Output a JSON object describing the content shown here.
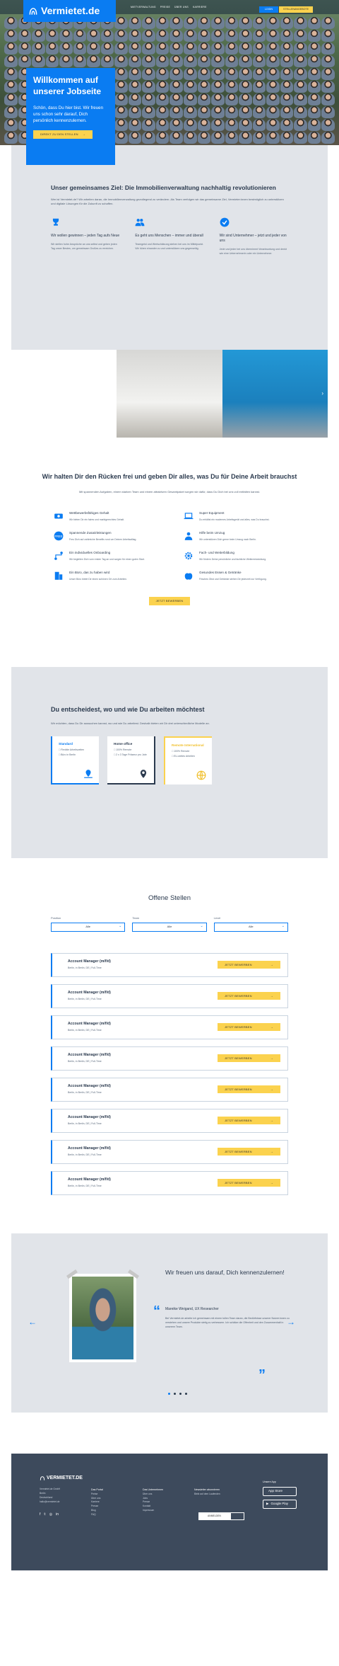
{
  "brand": "Vermietet.de",
  "nav": [
    "MIETVERWALTUNG",
    "PREISE",
    "ÜBER UNS",
    "KARRIERE"
  ],
  "login": "LOGIN",
  "jobs_btn": "STELLENANGEBOTE",
  "hero": {
    "title": "Willkommen auf unserer Jobseite",
    "subtitle": "Schön, dass Du hier bist. Wir freuen uns schon sehr darauf, Dich persönlich kennenzulernen.",
    "cta": "DIREKT ZU DEN STELLEN"
  },
  "mission": {
    "title": "Unser gemeinsames Ziel: Die Immobilienverwaltung nachhaltig revolutionieren",
    "lead": "Wer ist Vermietet.de? Wir arbeiten daran, die Immobilienverwaltung grundlegend zu verändern. Als Team verfolgen wir das gemeinsame Ziel, Vermieter:innen bestmöglich zu unterstützen und digitale Lösungen für die Zukunft zu schaffen.",
    "cols": [
      {
        "icon": "trophy-icon",
        "title": "Wir wollen gewinnen – jeden Tag aufs Neue",
        "text": "Wir stellen hohe Ansprüche an uns selbst und geben jeden Tag unser Bestes, um gemeinsam Großes zu erreichen."
      },
      {
        "icon": "people-icon",
        "title": "Es geht uns Menschen – immer und überall",
        "text": "Teamgeist und Wertschätzung stehen bei uns im Mittelpunkt. Wir hören einander zu und unterstützen uns gegenseitig."
      },
      {
        "icon": "check-icon",
        "title": "Wir sind Unternehmer – jetzt und jeder von uns",
        "text": "Jede und jeder bei uns übernimmt Verantwortung und denkt wie eine Unternehmerin oder ein Unternehmer."
      }
    ]
  },
  "benefits": {
    "title": "Wir halten Dir den Rücken frei und geben Dir alles, was Du für Deine Arbeit brauchst",
    "lead": "Mit spannenden Aufgaben, einem starken Team und einem attraktiven Gesamtpaket sorgen wir dafür, dass Du Dich bei uns voll entfalten kannst.",
    "items": [
      {
        "icon": "money-icon",
        "title": "Wettbewerbsfähiges Gehalt",
        "text": "Wir bieten Dir ein faires und marktgerechtes Gehalt."
      },
      {
        "icon": "laptop-icon",
        "title": "Super Equipment",
        "text": "Du erhältst ein modernes Arbeitsgerät und alles, was Du brauchst."
      },
      {
        "icon": "free-badge-icon",
        "title": "Spannende Zusatzleistungen",
        "text": "Freu Dich auf zahlreiche Benefits rund um Deinen Arbeitsalltag."
      },
      {
        "icon": "worker-icon",
        "title": "Hilfe beim Umzug",
        "text": "Wir unterstützen Dich gerne beim Umzug nach Berlin."
      },
      {
        "icon": "path-icon",
        "title": "Ein individuelles Onboarding",
        "text": "Wir begleiten Dich vom ersten Tag an und sorgen für einen guten Start."
      },
      {
        "icon": "gears-icon",
        "title": "Fach- und Weiterbildung",
        "text": "Wir fördern Deine persönliche und fachliche Weiterentwicklung."
      },
      {
        "icon": "building-icon",
        "title": "Ein Büro, das zu haben wird",
        "text": "Unser Büro bietet Dir einen schönen Ort zum Arbeiten."
      },
      {
        "icon": "apple-icon",
        "title": "Gesundes Essen & Getränke",
        "text": "Frisches Obst und Getränke stehen Dir jederzeit zur Verfügung."
      }
    ],
    "cta": "JETZT BEWERBEN"
  },
  "work": {
    "title": "Du entscheidest, wo und wie Du arbeiten möchtest",
    "lead": "Wir möchten, dass Du Dir aussuchen kannst, wo und wie Du arbeitest. Deshalb bieten wir Dir drei unterschiedliche Modelle an.",
    "cards": [
      {
        "title": "Standard",
        "opts": [
          "Flexible Arbeitszeiten",
          "Büro in Berlin"
        ]
      },
      {
        "title": "Home office",
        "opts": [
          "100% Remote",
          "2 x 3 Tage Präsenz pro Jahr"
        ]
      },
      {
        "title": "Remote International",
        "opts": [
          "100% Remote",
          "EU-weites Arbeiten"
        ]
      }
    ]
  },
  "jobs": {
    "title": "Offene Stellen",
    "filters": [
      {
        "label": "Position",
        "value": "Alle"
      },
      {
        "label": "Team",
        "value": "Alle"
      },
      {
        "label": "Level",
        "value": "Alle"
      }
    ],
    "list": [
      {
        "title": "Account Manager (m/f/d)",
        "meta": "Berlin, in Berlin, DE | Full-Time"
      },
      {
        "title": "Account Manager (m/f/d)",
        "meta": "Berlin, in Berlin, DE | Full-Time"
      },
      {
        "title": "Account Manager (m/f/d)",
        "meta": "Berlin, in Berlin, DE | Full-Time"
      },
      {
        "title": "Account Manager (m/f/d)",
        "meta": "Berlin, in Berlin, DE | Full-Time"
      },
      {
        "title": "Account Manager (m/f/d)",
        "meta": "Berlin, in Berlin, DE | Full-Time"
      },
      {
        "title": "Account Manager (m/f/d)",
        "meta": "Berlin, in Berlin, DE | Full-Time"
      },
      {
        "title": "Account Manager (m/f/d)",
        "meta": "Berlin, in Berlin, DE | Full-Time"
      },
      {
        "title": "Account Manager (m/f/d)",
        "meta": "Berlin, in Berlin, DE | Full-Time"
      }
    ],
    "apply": "JETZT BEWERBEN"
  },
  "testimonial": {
    "title": "Wir freuen uns darauf, Dich kennenzulernen!",
    "name": "Mareike Weigand, UX Researcher",
    "quote": "Bei Vermietet.de arbeite ich gemeinsam mit einem tollen Team daran, die Bedürfnisse unserer Nutzer:innen zu verstehen und unsere Produkte stetig zu verbessern. Ich schätze die Offenheit und den Zusammenhalt in unserem Team."
  },
  "footer": {
    "brand": "VERMIETET.DE",
    "address": [
      "Vermietet.de GmbH",
      "Berlin",
      "Deutschland",
      "hallo@vermietet.de"
    ],
    "cols": [
      {
        "title": "Das Portal",
        "links": [
          "Preise",
          "Über uns",
          "Karriere",
          "Presse",
          "Blog",
          "FAQ"
        ]
      },
      {
        "title": "Das Unternehmen",
        "links": [
          "Über uns",
          "Jobs",
          "Presse",
          "Kontakt",
          "Impressum"
        ]
      },
      {
        "title": "Newsletter abonnieren",
        "links": [
          "Bleib auf dem Laufenden"
        ]
      }
    ],
    "newsletter_btn": "ANMELDEN",
    "apps_title": "Unsere App",
    "app_store": "App Store",
    "google_play": "Google Play"
  },
  "colors": {
    "primary": "#0a7cf2",
    "accent": "#fbd24e",
    "dark": "#2b3a4e",
    "footer": "#3d4a5c"
  }
}
